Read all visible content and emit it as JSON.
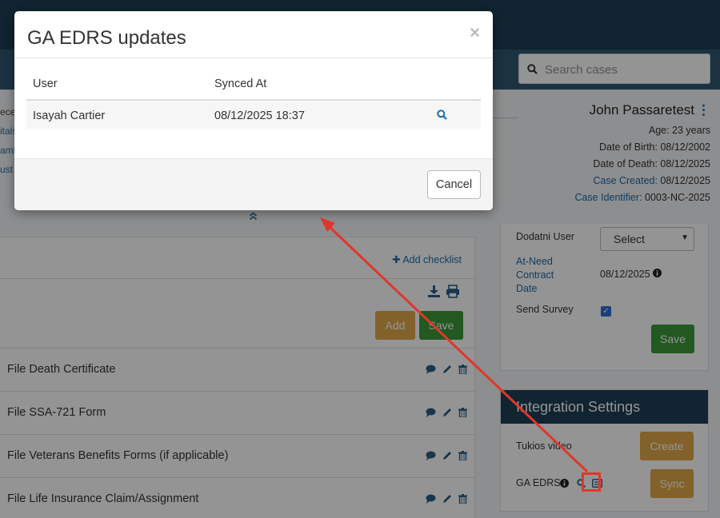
{
  "header": {
    "search_placeholder": "Search cases"
  },
  "left_cut": [
    "ece",
    "itals",
    "ami",
    "ust"
  ],
  "person": {
    "name": "John Passaretest",
    "age": "Age: 23 years",
    "dob": "Date of Birth: 08/12/2002",
    "dod": "Date of Death: 08/12/2025",
    "case_created_label": "Case Created:",
    "case_created_value": " 08/12/2025",
    "case_identifier_label": "Case Identifier:",
    "case_identifier_value": " 0003-NC-2025"
  },
  "checklist": {
    "add_checklist": "Add checklist",
    "add_label": "Add",
    "save_label": "Save",
    "tasks": [
      "File Death Certificate",
      "File SSA-721 Form",
      "File Veterans Benefits Forms (if applicable)",
      "File Life Insurance Claim/Assignment"
    ]
  },
  "details": {
    "dodatni_user": "Dodatni User",
    "select_value": "Select",
    "at_need_1": "At-Need",
    "at_need_2": "Contract",
    "at_need_3": "Date",
    "at_need_value": "08/12/2025",
    "send_survey": "Send Survey",
    "save_label": "Save"
  },
  "integration": {
    "title": "Integration Settings",
    "tukios_label": "Tukios video",
    "create_label": "Create",
    "ga_edrs_label": "GA EDRS",
    "sync_label": "Sync"
  },
  "modal": {
    "title": "GA EDRS updates",
    "close": "×",
    "columns": {
      "user": "User",
      "synced_at": "Synced At"
    },
    "rows": [
      {
        "user": "Isayah Cartier",
        "synced_at": "08/12/2025 18:37"
      }
    ],
    "cancel_label": "Cancel"
  },
  "colors": {
    "navy": "#1c3f55",
    "accent_blue": "#1e6aa5",
    "orange": "#e0a84a",
    "green": "#3a9a3a",
    "highlight_red": "#e0372b"
  }
}
